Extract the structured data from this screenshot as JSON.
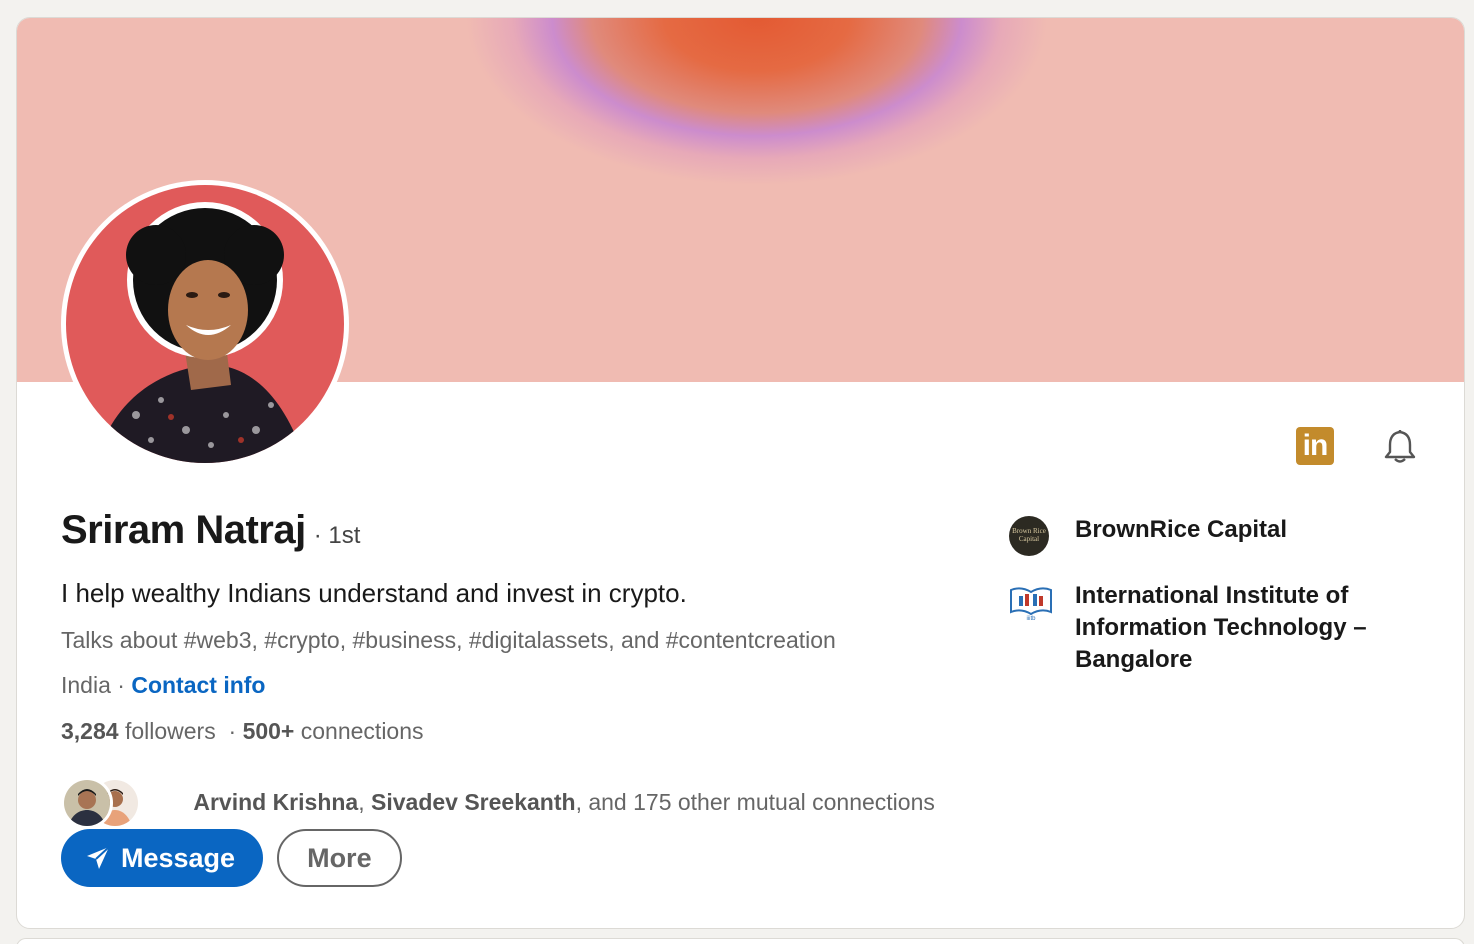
{
  "profile": {
    "name": "Sriram Natraj",
    "degree": "· 1st",
    "headline": "I help wealthy Indians understand and invest in crypto.",
    "talks_about": "Talks about #web3, #crypto, #business, #digitalassets, and #contentcreation",
    "location": "India",
    "location_separator": " · ",
    "contact_info": "Contact info",
    "followers_count": "3,284",
    "followers_label": " followers",
    "stats_separator": "  · ",
    "connections_count": "500+",
    "connections_label": " connections",
    "mutual": {
      "name1": "Arvind Krishna",
      "sep": ", ",
      "name2": "Sivadev Sreekanth",
      "rest": ", and 175 other mutual connections"
    }
  },
  "actions": {
    "message_label": "Message",
    "more_label": "More"
  },
  "top_icons": {
    "linkedin": "in",
    "bell": "bell-icon"
  },
  "orgs": [
    {
      "name": "BrownRice Capital",
      "logo_text": "Brown Rice Capital"
    },
    {
      "name": "International Institute of Information Technology – Bangalore",
      "logo_text": "iiitb"
    }
  ],
  "colors": {
    "accent": "#0a66c2",
    "avatar_bg": "#e05a5a",
    "linkedin_badge": "#c38b2c"
  }
}
